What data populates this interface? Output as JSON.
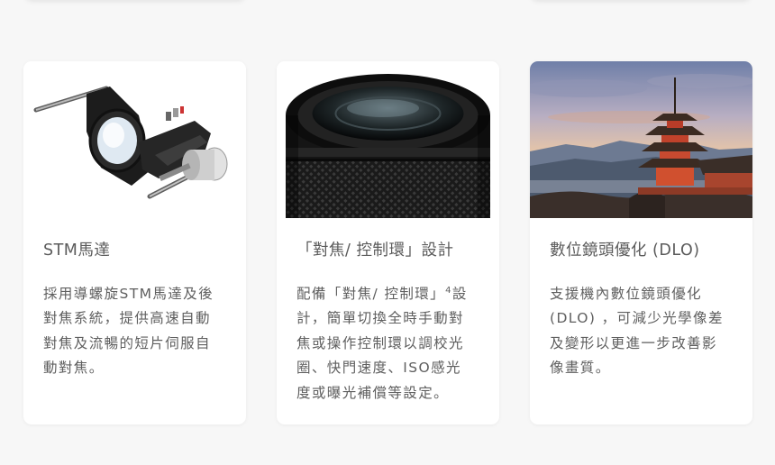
{
  "cards": [
    {
      "image_alt": "stm-motor-mechanism",
      "title": "STM馬達",
      "body_lines": [
        "採用導螺旋STM馬達及後",
        "對焦系統，提供高速自動",
        "對焦及流暢的短片伺服自",
        "動對焦。"
      ]
    },
    {
      "image_alt": "lens-focus-control-ring",
      "title": "「對焦/ 控制環」設計",
      "body_lines": [
        "配備「對焦/ 控制環」",
        "計，簡單切換全時手動對",
        "焦或操作控制環以調校光",
        "圈、快門速度、ISO感光",
        "度或曝光補償等設定。"
      ],
      "body_first_line_sup": "4",
      "body_first_line_tail": "設"
    },
    {
      "image_alt": "kyoto-pagoda-photo",
      "title": "數位鏡頭優化 (DLO)",
      "body_lines": [
        "支援機內數位鏡頭優化",
        "(DLO) ，可減少光學像差",
        "及變形以更進一步改善影",
        "像畫質。"
      ]
    }
  ],
  "colors": {
    "page_bg": "#f7f7f7",
    "card_bg": "#ffffff",
    "title_text": "#5b5b5b",
    "body_text": "#5f5f5f"
  }
}
